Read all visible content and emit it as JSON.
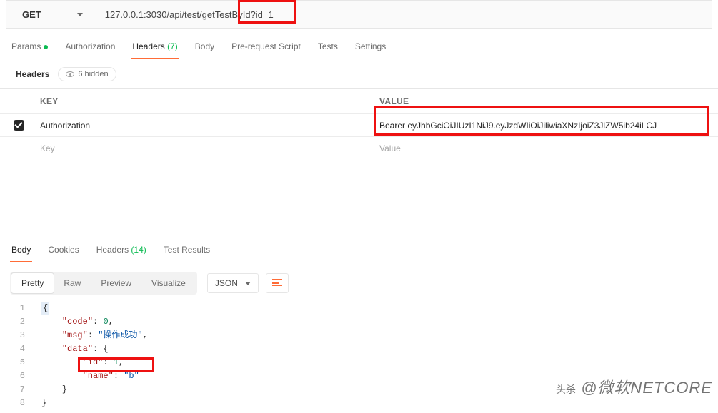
{
  "request": {
    "method": "GET",
    "url": "127.0.0.1:3030/api/test/getTestById?id=1"
  },
  "tabs": {
    "params": "Params",
    "authorization": "Authorization",
    "headers": "Headers",
    "headers_count": "(7)",
    "body": "Body",
    "prerequest": "Pre-request Script",
    "tests": "Tests",
    "settings": "Settings"
  },
  "headers_section": {
    "title": "Headers",
    "hidden_label": "6 hidden",
    "key_col": "KEY",
    "value_col": "VALUE",
    "rows": [
      {
        "key": "Authorization",
        "value": "Bearer eyJhbGciOiJIUzI1NiJ9.eyJzdWIiOiJiliwiaXNzIjoiZ3JlZW5ib24iLCJ"
      }
    ],
    "key_placeholder": "Key",
    "value_placeholder": "Value"
  },
  "response": {
    "tabs": {
      "body": "Body",
      "cookies": "Cookies",
      "headers": "Headers",
      "headers_count": "(14)",
      "test_results": "Test Results"
    },
    "views": {
      "pretty": "Pretty",
      "raw": "Raw",
      "preview": "Preview",
      "visualize": "Visualize"
    },
    "format": "JSON",
    "lines": [
      "{",
      "    \"code\": 0,",
      "    \"msg\": \"操作成功\",",
      "    \"data\": {",
      "        \"id\": 1,",
      "        \"name\": \"b\"",
      "    }",
      "}"
    ]
  },
  "watermark": {
    "prefix": "头杀",
    "handle": "@微软NETCORE"
  }
}
